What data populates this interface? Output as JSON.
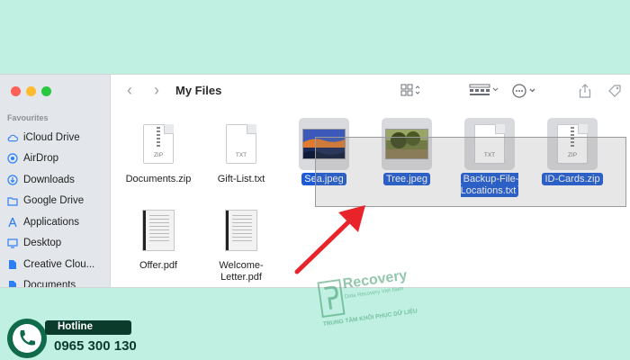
{
  "sidebar": {
    "heading": "Favourites",
    "items": [
      {
        "label": "iCloud Drive",
        "icon": "cloud-icon"
      },
      {
        "label": "AirDrop",
        "icon": "airdrop-icon"
      },
      {
        "label": "Downloads",
        "icon": "downloads-icon"
      },
      {
        "label": "Google Drive",
        "icon": "folder-icon"
      },
      {
        "label": "Applications",
        "icon": "applications-icon"
      },
      {
        "label": "Desktop",
        "icon": "desktop-icon"
      },
      {
        "label": "Creative Clou...",
        "icon": "document-icon"
      },
      {
        "label": "Documents",
        "icon": "document-icon"
      }
    ]
  },
  "toolbar": {
    "title": "My Files"
  },
  "files": [
    {
      "label": "Documents.zip",
      "ext": "ZIP",
      "kind": "zip",
      "selected": false
    },
    {
      "label": "Gift-List.txt",
      "ext": "TXT",
      "kind": "txt",
      "selected": false
    },
    {
      "label": "Sea.jpeg",
      "kind": "image",
      "selected": true
    },
    {
      "label": "Tree.jpeg",
      "kind": "image",
      "selected": true
    },
    {
      "label": "Backup-File-Locations.txt",
      "ext": "TXT",
      "kind": "txt",
      "selected": true
    },
    {
      "label": "ID-Cards.zip",
      "ext": "ZIP",
      "kind": "zip",
      "selected": true
    },
    {
      "label": "Offer.pdf",
      "kind": "pdf",
      "selected": false
    },
    {
      "label": "Welcome-Letter.pdf",
      "kind": "pdf",
      "selected": false
    }
  ],
  "overlay": {
    "hotline_label": "Hotline",
    "hotline_number": "0965 300 130",
    "watermark_brand": "Recovery",
    "watermark_sub": "Data Recovery Viet Nam",
    "watermark_tagline": "TRUNG TÂM KHÔI PHỤC DỮ LIỆU"
  },
  "colors": {
    "selection": "#1d5bd6",
    "accent": "#2e7ff6",
    "background": "#bff0e2",
    "arrow": "#e8232a"
  }
}
